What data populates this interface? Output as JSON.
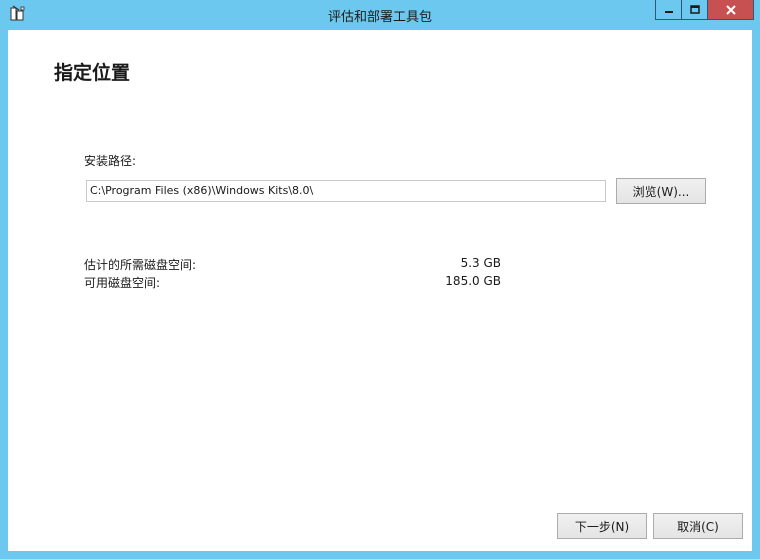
{
  "window": {
    "title": "评估和部署工具包",
    "icon": "installer-app-icon",
    "frame_color": "#6cc8ee",
    "close_color": "#c75050"
  },
  "page": {
    "heading": "指定位置"
  },
  "install_path": {
    "label": "安装路径:",
    "value": "C:\\Program Files (x86)\\Windows Kits\\8.0\\",
    "browse_label": "浏览(W)..."
  },
  "disk": {
    "estimated_label": "估计的所需磁盘空间:",
    "estimated_value": "5.3 GB",
    "available_label": "可用磁盘空间:",
    "available_value": "185.0 GB"
  },
  "footer": {
    "next_label": "下一步(N)",
    "cancel_label": "取消(C)"
  }
}
